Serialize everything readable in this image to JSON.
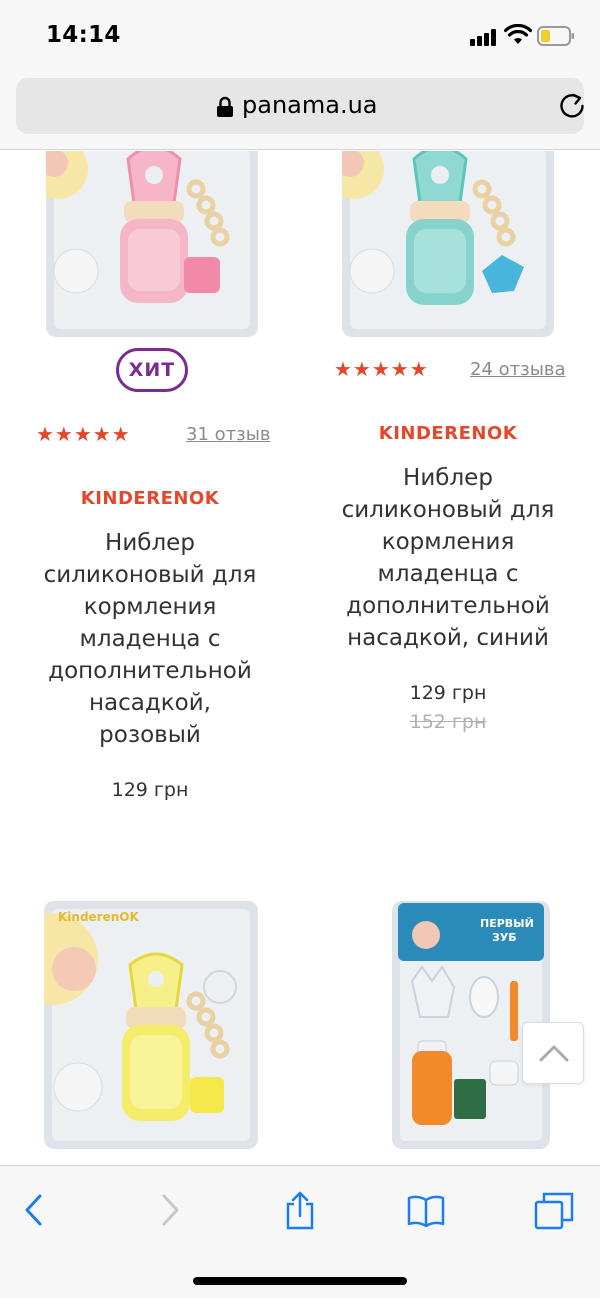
{
  "status": {
    "time": "14:14"
  },
  "browser": {
    "url": "panama.ua"
  },
  "products": [
    {
      "badge": "ХИТ",
      "stars": "★★★★★",
      "reviews": "31 отзыв",
      "brand": "KINDERENOK",
      "title_lines": [
        "Ниблер",
        "силиконовый для",
        "кормления",
        "младенца с",
        "дополнительной",
        "насадкой,",
        "розовый"
      ],
      "price": "129 грн",
      "image_colors": {
        "body": "#f4a9bf",
        "accent": "#f08aa8"
      }
    },
    {
      "stars": "★★★★★",
      "reviews": "24 отзыва",
      "brand": "KINDERENOK",
      "title_lines": [
        "Ниблер",
        "силиконовый для",
        "кормления",
        "младенца с",
        "дополнительной",
        "насадкой, синий"
      ],
      "price": "129 грн",
      "old_price": "152 грн",
      "image_colors": {
        "body": "#7fd3cf",
        "accent": "#48b6dc"
      }
    },
    {
      "image_colors": {
        "body": "#f5ec6a",
        "accent": "#f4e84a"
      },
      "image_text": "KinderenOK"
    },
    {
      "image_colors": {
        "body": "#f28a2c",
        "accent": "#2a8bb8"
      },
      "image_text": [
        "ПЕРВЫЙ",
        "ЗУБ"
      ]
    }
  ],
  "icons": [
    "lock-icon",
    "reload-icon",
    "chevron-up-icon",
    "back-icon",
    "forward-icon",
    "share-icon",
    "bookmarks-icon",
    "tabs-icon"
  ],
  "colors": {
    "brand": "#e4472b",
    "hit": "#7a2d8e",
    "ios_blue": "#1a7ef2"
  }
}
